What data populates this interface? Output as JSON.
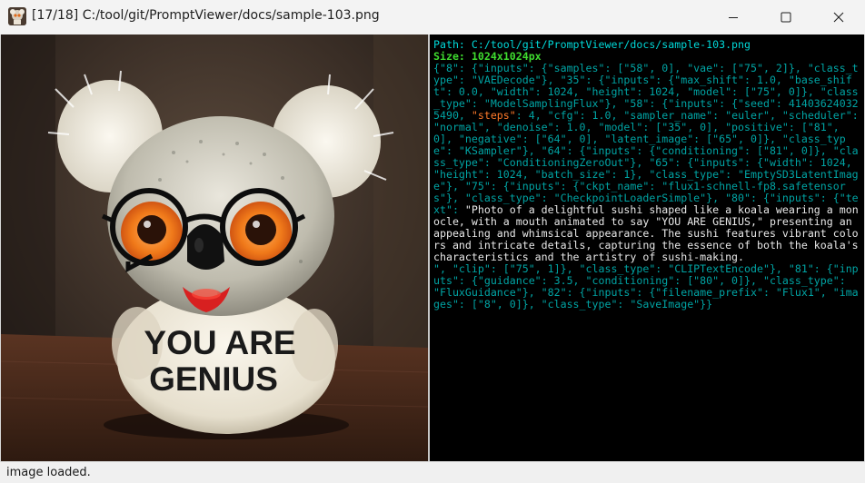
{
  "window": {
    "title": "[17/18] C:/tool/git/PromptViewer/docs/sample-103.png",
    "icon": "app-thumbnail-icon",
    "controls": {
      "minimize": "minimize-icon",
      "maximize": "maximize-icon",
      "close": "close-icon"
    }
  },
  "image": {
    "description_icon": "koala-sushi-image",
    "shirt_text_line1": "YOU ARE",
    "shirt_text_line2": "GENIUS"
  },
  "metadata": {
    "path_line": "Path: C:/tool/git/PromptViewer/docs/sample-103.png",
    "size_line": "Size: 1024x1024px",
    "json_before_steps": "{\"8\": {\"inputs\": {\"samples\": [\"58\", 0], \"vae\": [\"75\", 2]}, \"class_type\": \"VAEDecode\"}, \"35\": {\"inputs\": {\"max_shift\": 1.0, \"base_shift\": 0.0, \"width\": 1024, \"height\": 1024, \"model\": [\"75\", 0]}, \"class_type\": \"ModelSamplingFlux\"}, \"58\": {\"inputs\": {\"seed\": 414036240325490, ",
    "steps_key": "\"steps\"",
    "json_after_steps": ": 4, \"cfg\": 1.0, \"sampler_name\": \"euler\", \"scheduler\": \"normal\", \"denoise\": 1.0, \"model\": [\"35\", 0], \"positive\": [\"81\", 0], \"negative\": [\"64\", 0], \"latent_image\": [\"65\", 0]}, \"class_type\": \"KSampler\"}, \"64\": {\"inputs\": {\"conditioning\": [\"81\", 0]}, \"class_type\": \"ConditioningZeroOut\"}, \"65\": {\"inputs\": {\"width\": 1024, \"height\": 1024, \"batch_size\": 1}, \"class_type\": \"EmptySD3LatentImage\"}, \"75\": {\"inputs\": {\"ckpt_name\": \"flux1-schnell-fp8.safetensors\"}, \"class_type\": \"CheckpointLoaderSimple\"}, \"80\": {\"inputs\": {\"text\": ",
    "prompt_text": "\"Photo of a delightful sushi shaped like a koala wearing a monocle, with a mouth animated to say \"YOU ARE GENIUS,\" presenting an appealing and whimsical appearance. The sushi features vibrant colors and intricate details, capturing the essence of both the koala's characteristics and the artistry of sushi-making.\n",
    "json_after_prompt": "\", \"clip\": [\"75\", 1]}, \"class_type\": \"CLIPTextEncode\"}, \"81\": {\"inputs\": {\"guidance\": 3.5, \"conditioning\": [\"80\", 0]}, \"class_type\": \"FluxGuidance\"}, \"82\": {\"inputs\": {\"filename_prefix\": \"Flux1\", \"images\": [\"8\", 0]}, \"class_type\": \"SaveImage\"}}"
  },
  "status": {
    "text": "image loaded."
  },
  "colors": {
    "path": "#00d8d8",
    "size": "#3fdc2f",
    "json": "#00a4a4",
    "steps_highlight": "#ff7a2a",
    "prompt": "#e8e8e8",
    "text_pane_bg": "#000000"
  }
}
